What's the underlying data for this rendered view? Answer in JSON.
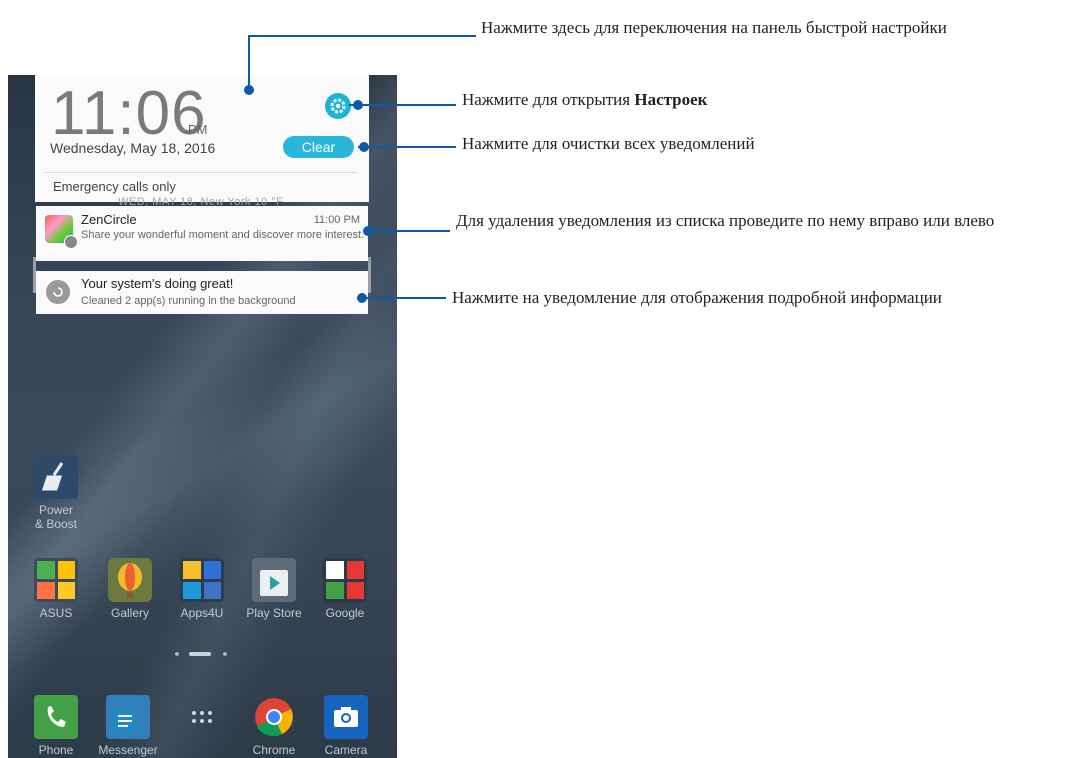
{
  "lock_panel": {
    "time": "11:06",
    "ampm": "PM",
    "date": "Wednesday, May 18, 2016",
    "clear_label": "Clear",
    "emergency": "Emergency calls only",
    "background_text": "WED, MAY 18, New York 10 °F"
  },
  "notifications": [
    {
      "app": "ZenCircle",
      "time": "11:00 PM",
      "text": "Share your wonderful moment and discover more interest."
    },
    {
      "app": "Your system's doing great!",
      "time": "",
      "text": "Cleaned 2 app(s) running in the background"
    }
  ],
  "apps": {
    "power_boost": "Power & Boost",
    "row": [
      "ASUS",
      "Gallery",
      "Apps4U",
      "Play Store",
      "Google"
    ],
    "dock": [
      "Phone",
      "Messenger",
      "",
      "Chrome",
      "Camera"
    ]
  },
  "callouts": {
    "quick_settings": "Нажмите здесь для переключения на панель быстрой настройки",
    "settings_prefix": "Нажмите для открытия ",
    "settings_bold": "Настроек",
    "clear": "Нажмите для очистки всех уведомлений",
    "swipe": "Для удаления уведомления из списка проведите по нему вправо или влево",
    "tap": "Нажмите на уведомление для отображения подробной информации"
  },
  "colors": {
    "accent": "#1eb3d8",
    "callout_line": "#0e5aa7"
  }
}
